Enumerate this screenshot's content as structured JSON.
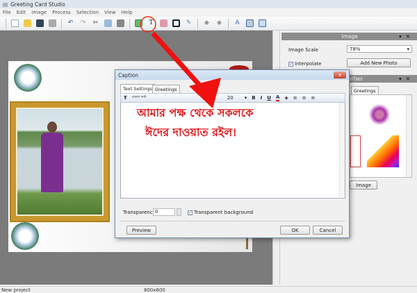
{
  "app": {
    "title": "Greeting Card Studio"
  },
  "menu": [
    "File",
    "Edit",
    "Image",
    "Process",
    "Selection",
    "View",
    "Help"
  ],
  "toolbar": {
    "icons": [
      "new-icon",
      "open-icon",
      "save-icon",
      "print-icon",
      "undo-icon",
      "redo-icon",
      "cut-icon",
      "copy-icon",
      "paste-icon",
      "add-image-icon",
      "text-icon",
      "insert-picture-icon",
      "frame-icon",
      "effects-icon",
      "move-up-icon",
      "move-down-icon",
      "zoom-icon",
      "page-icon",
      "export-icon"
    ]
  },
  "image_panel": {
    "title": "Image",
    "scale_label": "Image Scale",
    "scale_value": "78%",
    "interpolate_label": "Interpolate",
    "interpolate_checked": true,
    "add_photo": "Add New Photo"
  },
  "properties_panel": {
    "title": "Properties",
    "title_visible": "perties",
    "tab_greetings": "Greetings",
    "button_visible": "Image"
  },
  "dialog": {
    "title": "Caption",
    "close": "x",
    "tabs": [
      "Text Settings",
      "Greetings"
    ],
    "font_name": "বাংলা ফন্ট",
    "font_size": "20",
    "bold": "B",
    "italic": "I",
    "underline": "U",
    "font_color": "A",
    "highlight": "◈",
    "text_lines": [
      "আমার পক্ষ থেকে সকলকে",
      "ঈদের দাওয়াত রইল।"
    ],
    "text_color": "#e0161b",
    "transparency_label": "Transparency",
    "transparency_value": "0",
    "transparent_bg_label": "Transparent background",
    "transparent_bg_checked": true,
    "preview": "Preview",
    "ok": "OK",
    "cancel": "Cancel"
  },
  "status": {
    "left": "New project",
    "size": "800x600"
  }
}
